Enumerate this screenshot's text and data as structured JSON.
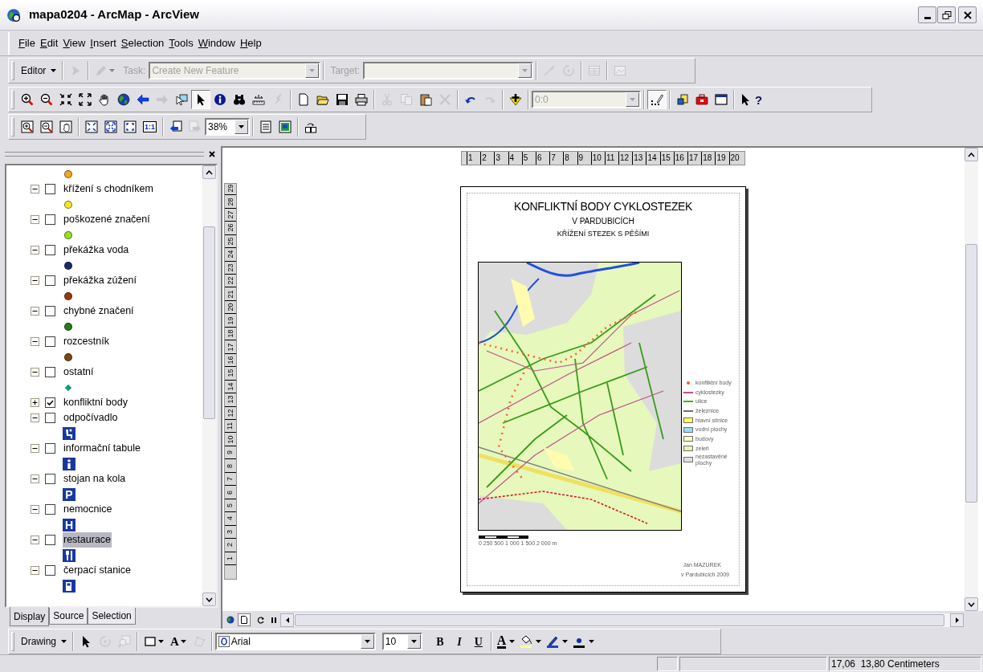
{
  "window": {
    "title": "mapa0204 - ArcMap - ArcView"
  },
  "menu": [
    "File",
    "Edit",
    "View",
    "Insert",
    "Selection",
    "Tools",
    "Window",
    "Help"
  ],
  "editor_toolbar": {
    "menu": "Editor",
    "tools_left": [
      {
        "disabled": true
      },
      {
        "disabled": true
      }
    ],
    "task_label": "Task:",
    "task": {
      "value": "Create New Feature",
      "disabled": true
    },
    "target_label": "Target:",
    "target": {
      "disabled": true
    },
    "tools_right": [
      {
        "disabled": true
      },
      {
        "disabled": true
      },
      {
        "disabled": true
      },
      {
        "disabled": true
      }
    ]
  },
  "tools_toolbar": {
    "left": [
      {
        "disabled": false,
        "selected": false
      },
      {
        "disabled": false,
        "selected": false
      },
      {
        "disabled": false,
        "selected": false
      },
      {
        "disabled": false,
        "selected": false
      },
      {
        "disabled": false,
        "selected": false
      },
      {
        "disabled": false,
        "selected": false
      },
      {
        "disabled": false,
        "selected": false
      },
      {
        "disabled": true,
        "selected": false
      },
      {
        "disabled": false,
        "selected": false
      },
      {
        "disabled": false,
        "selected": true
      },
      {
        "disabled": false,
        "selected": false
      },
      {
        "disabled": false,
        "selected": false
      },
      {
        "disabled": false,
        "selected": false
      },
      {
        "disabled": true,
        "selected": false
      },
      {
        "disabled": false
      },
      {
        "disabled": false
      },
      {
        "disabled": false
      },
      {
        "disabled": false
      },
      {
        "disabled": true
      },
      {
        "disabled": true
      },
      {
        "disabled": false
      },
      {
        "disabled": true
      },
      {
        "disabled": false
      },
      {
        "disabled": true
      },
      {
        "disabled": false
      }
    ],
    "scale": {
      "value": "0:0",
      "disabled": true
    },
    "right": [
      {
        "disabled": false,
        "selected": true
      },
      {
        "disabled": false,
        "selected": false
      },
      {
        "disabled": false,
        "selected": false
      },
      {
        "disabled": false,
        "selected": false
      },
      {
        "disabled": false,
        "selected": false,
        "label": "?"
      }
    ]
  },
  "layout_toolbar": {
    "left": [
      {
        "disabled": false
      },
      {
        "disabled": false
      },
      {
        "disabled": false
      },
      {
        "disabled": false
      },
      {
        "disabled": false
      },
      {
        "disabled": false
      },
      {
        "disabled": false,
        "label": "1:1"
      },
      {
        "disabled": false
      },
      {
        "disabled": true
      }
    ],
    "zoom": {
      "value": "38%",
      "disabled": false
    },
    "right": [
      {
        "disabled": false
      },
      {
        "disabled": false
      },
      {
        "disabled": false
      }
    ]
  },
  "toc": {
    "leading_symbol": {
      "kind": "dot",
      "color": "#f5a623"
    },
    "layers": [
      {
        "label": "křížení s chodníkem",
        "expanded": true,
        "checked": false,
        "selected": false,
        "symbol": {
          "kind": "dot",
          "color": "#f5e61e"
        }
      },
      {
        "label": "poškozené značení",
        "expanded": true,
        "checked": false,
        "selected": false,
        "symbol": {
          "kind": "dot",
          "color": "#9be01e"
        }
      },
      {
        "label": "překážka voda",
        "expanded": true,
        "checked": false,
        "selected": false,
        "symbol": {
          "kind": "dot",
          "color": "#1a2a6a"
        }
      },
      {
        "label": "překážka zúžení",
        "expanded": true,
        "checked": false,
        "selected": false,
        "symbol": {
          "kind": "dot",
          "color": "#9a3a10"
        }
      },
      {
        "label": "chybné značení",
        "expanded": true,
        "checked": false,
        "selected": false,
        "symbol": {
          "kind": "dot",
          "color": "#2a7a1a"
        }
      },
      {
        "label": "rozcestník",
        "expanded": true,
        "checked": false,
        "selected": false,
        "symbol": {
          "kind": "dot",
          "color": "#7a4a10"
        }
      },
      {
        "label": "ostatní",
        "expanded": true,
        "checked": false,
        "selected": false,
        "symbol": {
          "kind": "diamond",
          "color": "#1a9a6a"
        }
      },
      {
        "label": "konfliktní body",
        "expanded": false,
        "checked": true,
        "selected": false
      },
      {
        "label": "odpočívadlo",
        "expanded": true,
        "checked": false,
        "selected": false,
        "symbol": {
          "kind": "rest"
        }
      },
      {
        "label": "informační tabule",
        "expanded": true,
        "checked": false,
        "selected": false,
        "symbol": {
          "kind": "info"
        }
      },
      {
        "label": "stojan na kola",
        "expanded": true,
        "checked": false,
        "selected": false,
        "symbol": {
          "kind": "letter",
          "glyph": "P"
        }
      },
      {
        "label": "nemocnice",
        "expanded": true,
        "checked": false,
        "selected": false,
        "symbol": {
          "kind": "letter",
          "glyph": "H"
        }
      },
      {
        "label": "restaurace",
        "expanded": true,
        "checked": false,
        "selected": true,
        "symbol": {
          "kind": "restaurant"
        }
      },
      {
        "label": "čerpací stanice",
        "expanded": true,
        "checked": false,
        "selected": false,
        "symbol": {
          "kind": "fuel"
        }
      }
    ],
    "tabs": [
      {
        "label": "Display",
        "selected": true
      },
      {
        "label": "Source",
        "selected": false
      },
      {
        "label": "Selection",
        "selected": false
      }
    ]
  },
  "rulers": {
    "horizontal": [
      "1",
      "2",
      "3",
      "4",
      "5",
      "6",
      "7",
      "8",
      "9",
      "10",
      "11",
      "12",
      "13",
      "14",
      "15",
      "16",
      "17",
      "18",
      "19",
      "20"
    ],
    "vertical": [
      "1",
      "2",
      "3",
      "4",
      "5",
      "6",
      "7",
      "8",
      "9",
      "10",
      "11",
      "12",
      "13",
      "14",
      "15",
      "16",
      "17",
      "18",
      "19",
      "20",
      "21",
      "22",
      "23",
      "24",
      "25",
      "26",
      "27",
      "28",
      "29"
    ]
  },
  "layout": {
    "title": "KONFLIKTNÍ BODY CYKLOSTEZEK",
    "subtitle": "V PARDUBICÍCH",
    "subtitle_2": "KŘÍŽENÍ STEZEK S PĚŠÍMI",
    "legend": [
      {
        "kind": "point",
        "label": "konfliktní body",
        "color": "#ff5a1e"
      },
      {
        "kind": "line",
        "label": "cyklostezky",
        "color": "#c0508a"
      },
      {
        "kind": "line",
        "label": "ulice",
        "color": "#4caa1e"
      },
      {
        "kind": "line",
        "label": "železnice",
        "color": "#707070"
      },
      {
        "kind": "fill",
        "label": "hlavní silnice",
        "color": "#ffff60"
      },
      {
        "kind": "fill",
        "label": "vodní plochy",
        "color": "#a0d8f8"
      },
      {
        "kind": "fill",
        "label": "budovy",
        "color": "#ffffc0"
      },
      {
        "kind": "fill",
        "label": "zeleň",
        "color": "#e0f8b0"
      },
      {
        "kind": "fill",
        "label": "nezastavěné plochy",
        "color": "#e0e0e0"
      }
    ],
    "scale_text": "0 250 500 1 000 1 500 2 000 m",
    "author": "Jan MAZUREK",
    "place_date": "v Pardubicích 2009"
  },
  "view_buttons": [
    {
      "kind": "data",
      "selected": false
    },
    {
      "kind": "layout",
      "selected": true
    }
  ],
  "drawing_toolbar": {
    "menu": "Drawing",
    "tools": [
      {
        "disabled": false
      },
      {
        "disabled": true
      },
      {
        "disabled": true
      },
      {
        "disabled": false
      },
      {
        "disabled": false,
        "label": "A"
      },
      {
        "disabled": true
      }
    ],
    "font": "Arial",
    "size": "10",
    "styles": [
      "B",
      "I",
      "U"
    ],
    "font_color_label": "A"
  },
  "status_bar": {
    "coordinates": "17,06  13,80 Centimeters"
  }
}
